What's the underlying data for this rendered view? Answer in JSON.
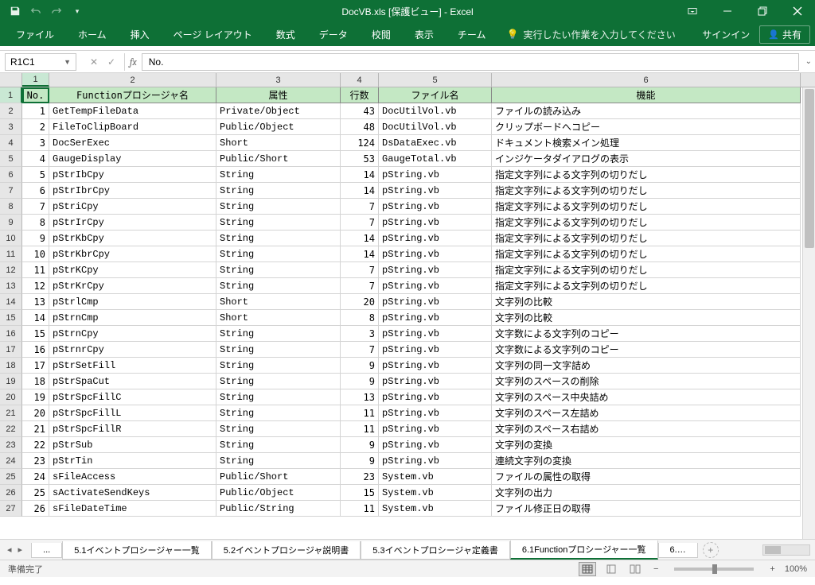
{
  "title": "DocVB.xls [保護ビュー] - Excel",
  "qat": {
    "save": "save",
    "undo": "undo",
    "redo": "redo"
  },
  "win": {
    "ribbon_opts": "ribbon-options",
    "min": "minimize",
    "restore": "restore",
    "close": "close"
  },
  "tabs": [
    "ファイル",
    "ホーム",
    "挿入",
    "ページ レイアウト",
    "数式",
    "データ",
    "校閲",
    "表示",
    "チーム"
  ],
  "tellme": "実行したい作業を入力してください",
  "signin": "サインイン",
  "share": "共有",
  "namebox": "R1C1",
  "formula": "No.",
  "col_nums": [
    "1",
    "2",
    "3",
    "4",
    "5",
    "6"
  ],
  "headers": {
    "no": "No.",
    "func": "Functionプロシージャ名",
    "attr": "属性",
    "lines": "行数",
    "file": "ファイル名",
    "feat": "機能"
  },
  "rows": [
    {
      "n": "1",
      "f": "GetTempFileData",
      "a": "Private/Object",
      "l": "43",
      "fi": "DocUtilVol.vb",
      "d": "ファイルの読み込み"
    },
    {
      "n": "2",
      "f": "FileToClipBoard",
      "a": "Public/Object",
      "l": "48",
      "fi": "DocUtilVol.vb",
      "d": "クリップボードへコピー"
    },
    {
      "n": "3",
      "f": "DocSerExec",
      "a": "Short",
      "l": "124",
      "fi": "DsDataExec.vb",
      "d": "ドキュメント検索メイン処理"
    },
    {
      "n": "4",
      "f": "GaugeDisplay",
      "a": "Public/Short",
      "l": "53",
      "fi": "GaugeTotal.vb",
      "d": "インジケータダイアログの表示"
    },
    {
      "n": "5",
      "f": "pStrIbCpy",
      "a": "String",
      "l": "14",
      "fi": "pString.vb",
      "d": "指定文字列による文字列の切りだし"
    },
    {
      "n": "6",
      "f": "pStrIbrCpy",
      "a": "String",
      "l": "14",
      "fi": "pString.vb",
      "d": "指定文字列による文字列の切りだし"
    },
    {
      "n": "7",
      "f": "pStriCpy",
      "a": "String",
      "l": "7",
      "fi": "pString.vb",
      "d": "指定文字列による文字列の切りだし"
    },
    {
      "n": "8",
      "f": "pStrIrCpy",
      "a": "String",
      "l": "7",
      "fi": "pString.vb",
      "d": "指定文字列による文字列の切りだし"
    },
    {
      "n": "9",
      "f": "pStrKbCpy",
      "a": "String",
      "l": "14",
      "fi": "pString.vb",
      "d": "指定文字列による文字列の切りだし"
    },
    {
      "n": "10",
      "f": "pStrKbrCpy",
      "a": "String",
      "l": "14",
      "fi": "pString.vb",
      "d": "指定文字列による文字列の切りだし"
    },
    {
      "n": "11",
      "f": "pStrKCpy",
      "a": "String",
      "l": "7",
      "fi": "pString.vb",
      "d": "指定文字列による文字列の切りだし"
    },
    {
      "n": "12",
      "f": "pStrKrCpy",
      "a": "String",
      "l": "7",
      "fi": "pString.vb",
      "d": "指定文字列による文字列の切りだし"
    },
    {
      "n": "13",
      "f": "pStrlCmp",
      "a": "Short",
      "l": "20",
      "fi": "pString.vb",
      "d": "文字列の比較"
    },
    {
      "n": "14",
      "f": "pStrnCmp",
      "a": "Short",
      "l": "8",
      "fi": "pString.vb",
      "d": "文字列の比較"
    },
    {
      "n": "15",
      "f": "pStrnCpy",
      "a": "String",
      "l": "3",
      "fi": "pString.vb",
      "d": "文字数による文字列のコピー"
    },
    {
      "n": "16",
      "f": "pStrnrCpy",
      "a": "String",
      "l": "7",
      "fi": "pString.vb",
      "d": "文字数による文字列のコピー"
    },
    {
      "n": "17",
      "f": "pStrSetFill",
      "a": "String",
      "l": "9",
      "fi": "pString.vb",
      "d": "文字列の同一文字詰め"
    },
    {
      "n": "18",
      "f": "pStrSpaCut",
      "a": "String",
      "l": "9",
      "fi": "pString.vb",
      "d": "文字列のスペースの削除"
    },
    {
      "n": "19",
      "f": "pStrSpcFillC",
      "a": "String",
      "l": "13",
      "fi": "pString.vb",
      "d": "文字列のスペース中央詰め"
    },
    {
      "n": "20",
      "f": "pStrSpcFillL",
      "a": "String",
      "l": "11",
      "fi": "pString.vb",
      "d": "文字列のスペース左詰め"
    },
    {
      "n": "21",
      "f": "pStrSpcFillR",
      "a": "String",
      "l": "11",
      "fi": "pString.vb",
      "d": "文字列のスペース右詰め"
    },
    {
      "n": "22",
      "f": "pStrSub",
      "a": "String",
      "l": "9",
      "fi": "pString.vb",
      "d": "文字列の変換"
    },
    {
      "n": "23",
      "f": "pStrTin",
      "a": "String",
      "l": "9",
      "fi": "pString.vb",
      "d": "連続文字列の変換"
    },
    {
      "n": "24",
      "f": "sFileAccess",
      "a": "Public/Short",
      "l": "23",
      "fi": "System.vb",
      "d": "ファイルの属性の取得"
    },
    {
      "n": "25",
      "f": "sActivateSendKeys",
      "a": "Public/Object",
      "l": "15",
      "fi": "System.vb",
      "d": "文字列の出力"
    },
    {
      "n": "26",
      "f": "sFileDateTime",
      "a": "Public/String",
      "l": "11",
      "fi": "System.vb",
      "d": "ファイル修正日の取得"
    }
  ],
  "sheets": {
    "more": "...",
    "s1": "5.1イベントプロシージャー一覧",
    "s2": "5.2イベントプロシージャ説明書",
    "s3": "5.3イベントプロシージャ定義書",
    "s4": "6.1Functionプロシージャー一覧",
    "s5": "6.… "
  },
  "status": "準備完了",
  "zoom": "100%"
}
